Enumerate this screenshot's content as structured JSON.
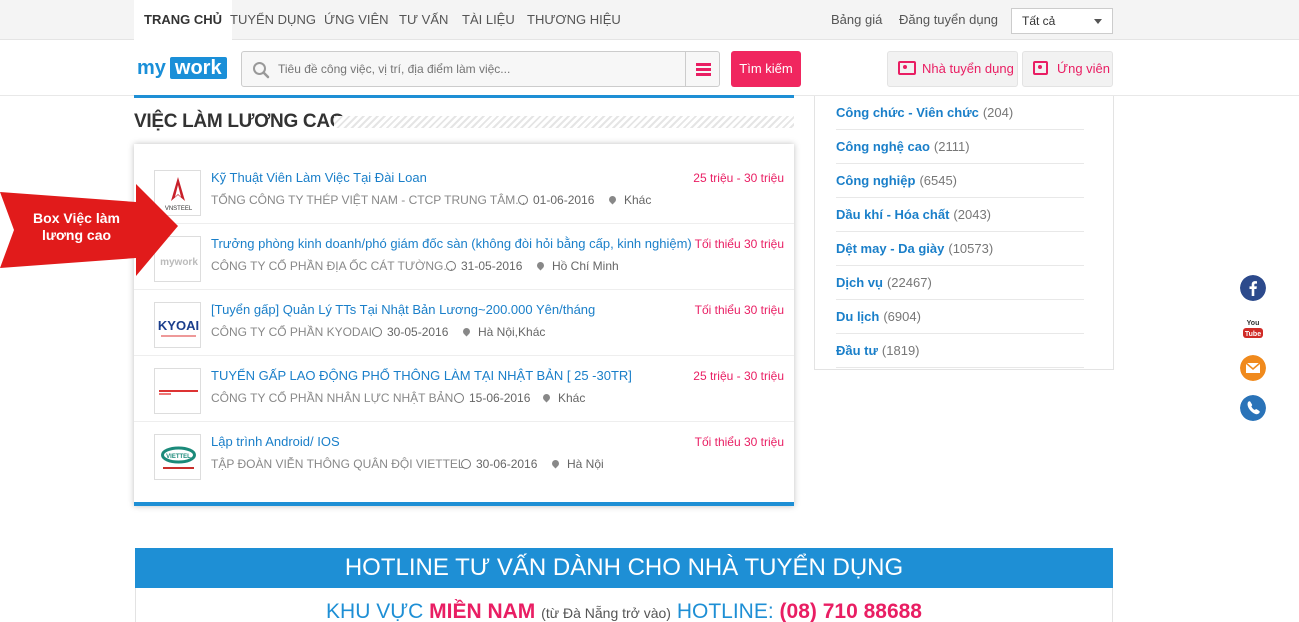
{
  "topnav": {
    "items": [
      "TRANG CHỦ",
      "TUYỂN DỤNG",
      "ỨNG VIÊN",
      "TƯ VẤN",
      "TÀI LIỆU",
      "THƯƠNG HIỆU"
    ],
    "pricing": "Bảng giá",
    "post_job": "Đăng tuyển dụng",
    "select_value": "Tất cả"
  },
  "header": {
    "logo_my": "my",
    "logo_work": "work",
    "search_placeholder": "Tiêu đề công việc, vị trí, địa điểm làm việc...",
    "search_button": "Tìm kiếm",
    "employer_button": "Nhà tuyển dụng",
    "candidate_button": "Ứng viên"
  },
  "section": {
    "title": "VIỆC LÀM LƯƠNG CAO"
  },
  "annotation": {
    "line1": "Box Việc làm",
    "line2": "lương cao"
  },
  "jobs": [
    {
      "title": "Kỹ Thuật Viên Làm Việc Tại Đài Loan",
      "company": "TỔNG CÔNG TY THÉP VIỆT NAM - CTCP TRUNG TÂM...",
      "date": "01-06-2016",
      "location": "Khác",
      "salary": "25 triệu - 30 triệu",
      "logo": "VNSTEEL"
    },
    {
      "title": "Trưởng phòng kinh doanh/phó giám đốc sàn (không đòi hỏi bằng cấp, kinh nghiệm)",
      "company": "CÔNG TY CỔ PHẦN ĐỊA ỐC CÁT TƯỜNG...",
      "date": "31-05-2016",
      "location": "Hồ Chí Minh",
      "salary": "Tối thiểu 30 triệu",
      "logo": "mywork"
    },
    {
      "title": "[Tuyển gấp] Quản Lý TTs Tại Nhật Bản Lương~200.000 Yên/tháng",
      "company": "CÔNG TY CỔ PHẦN KYODAI",
      "date": "30-05-2016",
      "location": "Hà Nội,Khác",
      "salary": "Tối thiểu 30 triệu",
      "logo": "KYOAI"
    },
    {
      "title": "TUYỂN GẤP LAO ĐỘNG PHỔ THÔNG LÀM TẠI NHẬT BẢN [ 25 -30TR]",
      "company": "CÔNG TY CỔ PHẦN NHÂN LỰC NHẬT BẢN",
      "date": "15-06-2016",
      "location": "Khác",
      "salary": "25 triệu - 30 triệu",
      "logo": ""
    },
    {
      "title": "Lập trình Android/ IOS",
      "company": "TẬP ĐOÀN VIỄN THÔNG QUÂN ĐỘI VIETTEL",
      "date": "30-06-2016",
      "location": "Hà Nội",
      "salary": "Tối thiểu 30 triệu",
      "logo": "VIETTEL"
    }
  ],
  "categories": [
    {
      "name": "Công chức - Viên chức",
      "count": "(204)"
    },
    {
      "name": "Công nghệ cao",
      "count": "(2111)"
    },
    {
      "name": "Công nghiệp",
      "count": "(6545)"
    },
    {
      "name": "Dầu khí - Hóa chất",
      "count": "(2043)"
    },
    {
      "name": "Dệt may - Da giày",
      "count": "(10573)"
    },
    {
      "name": "Dịch vụ",
      "count": "(22467)"
    },
    {
      "name": "Du lịch",
      "count": "(6904)"
    },
    {
      "name": "Đầu tư",
      "count": "(1819)"
    }
  ],
  "hotline": {
    "title": "HOTLINE TƯ VẤN DÀNH CHO NHÀ TUYỂN DỤNG",
    "region_prefix": "KHU VỰC",
    "region": "MIỀN NAM",
    "region_note": "(từ Đà Nẵng trở vào)",
    "hotline_label": "HOTLINE:",
    "phone": "(08) 710 88688"
  },
  "colors": {
    "brand_blue": "#1e8fd5",
    "accent_pink": "#e91e63"
  }
}
